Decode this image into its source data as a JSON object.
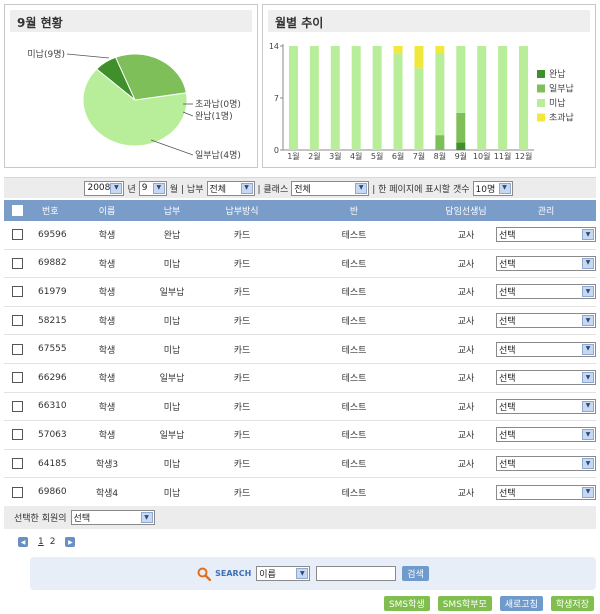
{
  "pie": {
    "title": "9월 현황",
    "labels": [
      {
        "text": "미납(9명)",
        "key": "unpaid"
      },
      {
        "text": "초과납(0명)",
        "key": "overpaid"
      },
      {
        "text": "완납(1명)",
        "key": "paid"
      },
      {
        "text": "일부납(4명)",
        "key": "partial"
      }
    ]
  },
  "monthly": {
    "title": "월별 추이",
    "legend": [
      "완납",
      "일부납",
      "미납",
      "초과납"
    ]
  },
  "colors": {
    "paid": "#3f8f2a",
    "partial": "#7fbf5a",
    "unpaid": "#b8ee9a",
    "overpaid": "#f0e83c",
    "header": "#7a9cc9"
  },
  "chart_data": [
    {
      "type": "pie",
      "title": "9월 현황",
      "slices": [
        {
          "label": "미납",
          "value": 9
        },
        {
          "label": "초과납",
          "value": 0
        },
        {
          "label": "완납",
          "value": 1
        },
        {
          "label": "일부납",
          "value": 4
        }
      ]
    },
    {
      "type": "bar",
      "title": "월별 추이",
      "stacked": true,
      "categories": [
        "1월",
        "2월",
        "3월",
        "4월",
        "5월",
        "6월",
        "7월",
        "8월",
        "9월",
        "10월",
        "11월",
        "12월"
      ],
      "ylim": [
        0,
        14
      ],
      "yticks": [
        0,
        7,
        14
      ],
      "legend_position": "right",
      "series": [
        {
          "name": "완납",
          "values": [
            0,
            0,
            0,
            0,
            0,
            0,
            0,
            0,
            1,
            0,
            0,
            0
          ]
        },
        {
          "name": "일부납",
          "values": [
            0,
            0,
            0,
            0,
            0,
            0,
            0,
            2,
            4,
            0,
            0,
            0
          ]
        },
        {
          "name": "미납",
          "values": [
            14,
            14,
            14,
            14,
            14,
            13,
            11,
            11,
            9,
            14,
            14,
            14
          ]
        },
        {
          "name": "초과납",
          "values": [
            0,
            0,
            0,
            0,
            0,
            1,
            3,
            1,
            0,
            0,
            0,
            0
          ]
        }
      ]
    }
  ],
  "filter": {
    "year": "2008",
    "year_unit": "년",
    "month": "9",
    "month_unit": "월",
    "pay_label": "| 납부",
    "pay_value": "전체",
    "class_label": "| 클래스",
    "class_value": "전체",
    "per_page_label": "| 한 페이지에 표시할 갯수",
    "per_page_value": "10명"
  },
  "table": {
    "headers": [
      "번호",
      "이름",
      "납부",
      "납부방식",
      "반",
      "담임선생님",
      "관리"
    ],
    "rows": [
      {
        "id": "69596",
        "name": "학생",
        "status": "완납",
        "method": "카드",
        "class": "테스트",
        "teacher": "교사",
        "manage": "선택"
      },
      {
        "id": "69882",
        "name": "학생",
        "status": "미납",
        "method": "카드",
        "class": "테스트",
        "teacher": "교사",
        "manage": "선택"
      },
      {
        "id": "61979",
        "name": "학생",
        "status": "일부납",
        "method": "카드",
        "class": "테스트",
        "teacher": "교사",
        "manage": "선택"
      },
      {
        "id": "58215",
        "name": "학생",
        "status": "미납",
        "method": "카드",
        "class": "테스트",
        "teacher": "교사",
        "manage": "선택"
      },
      {
        "id": "67555",
        "name": "학생",
        "status": "미납",
        "method": "카드",
        "class": "테스트",
        "teacher": "교사",
        "manage": "선택"
      },
      {
        "id": "66296",
        "name": "학생",
        "status": "일부납",
        "method": "카드",
        "class": "테스트",
        "teacher": "교사",
        "manage": "선택"
      },
      {
        "id": "66310",
        "name": "학생",
        "status": "미납",
        "method": "카드",
        "class": "테스트",
        "teacher": "교사",
        "manage": "선택"
      },
      {
        "id": "57063",
        "name": "학생",
        "status": "일부납",
        "method": "카드",
        "class": "테스트",
        "teacher": "교사",
        "manage": "선택"
      },
      {
        "id": "64185",
        "name": "학생3",
        "status": "미납",
        "method": "카드",
        "class": "테스트",
        "teacher": "교사",
        "manage": "선택"
      },
      {
        "id": "69860",
        "name": "학생4",
        "status": "미납",
        "method": "카드",
        "class": "테스트",
        "teacher": "교사",
        "manage": "선택"
      }
    ]
  },
  "bulk": {
    "label": "선택한 회원의",
    "value": "선택"
  },
  "pagination": {
    "pages": [
      "1",
      "2"
    ],
    "current": "1"
  },
  "search": {
    "label": "SEARCH",
    "field": "이름",
    "query": "",
    "button": "검색"
  },
  "actions": {
    "sms_student": "SMS학생",
    "sms_parent": "SMS학부모",
    "refresh": "새로고침",
    "save_student": "학생저장"
  },
  "icons": {
    "search": "magnifier-icon",
    "select_arrow": "chevron-down-icon",
    "page_prev": "arrow-left-icon",
    "page_next": "arrow-right-icon"
  }
}
